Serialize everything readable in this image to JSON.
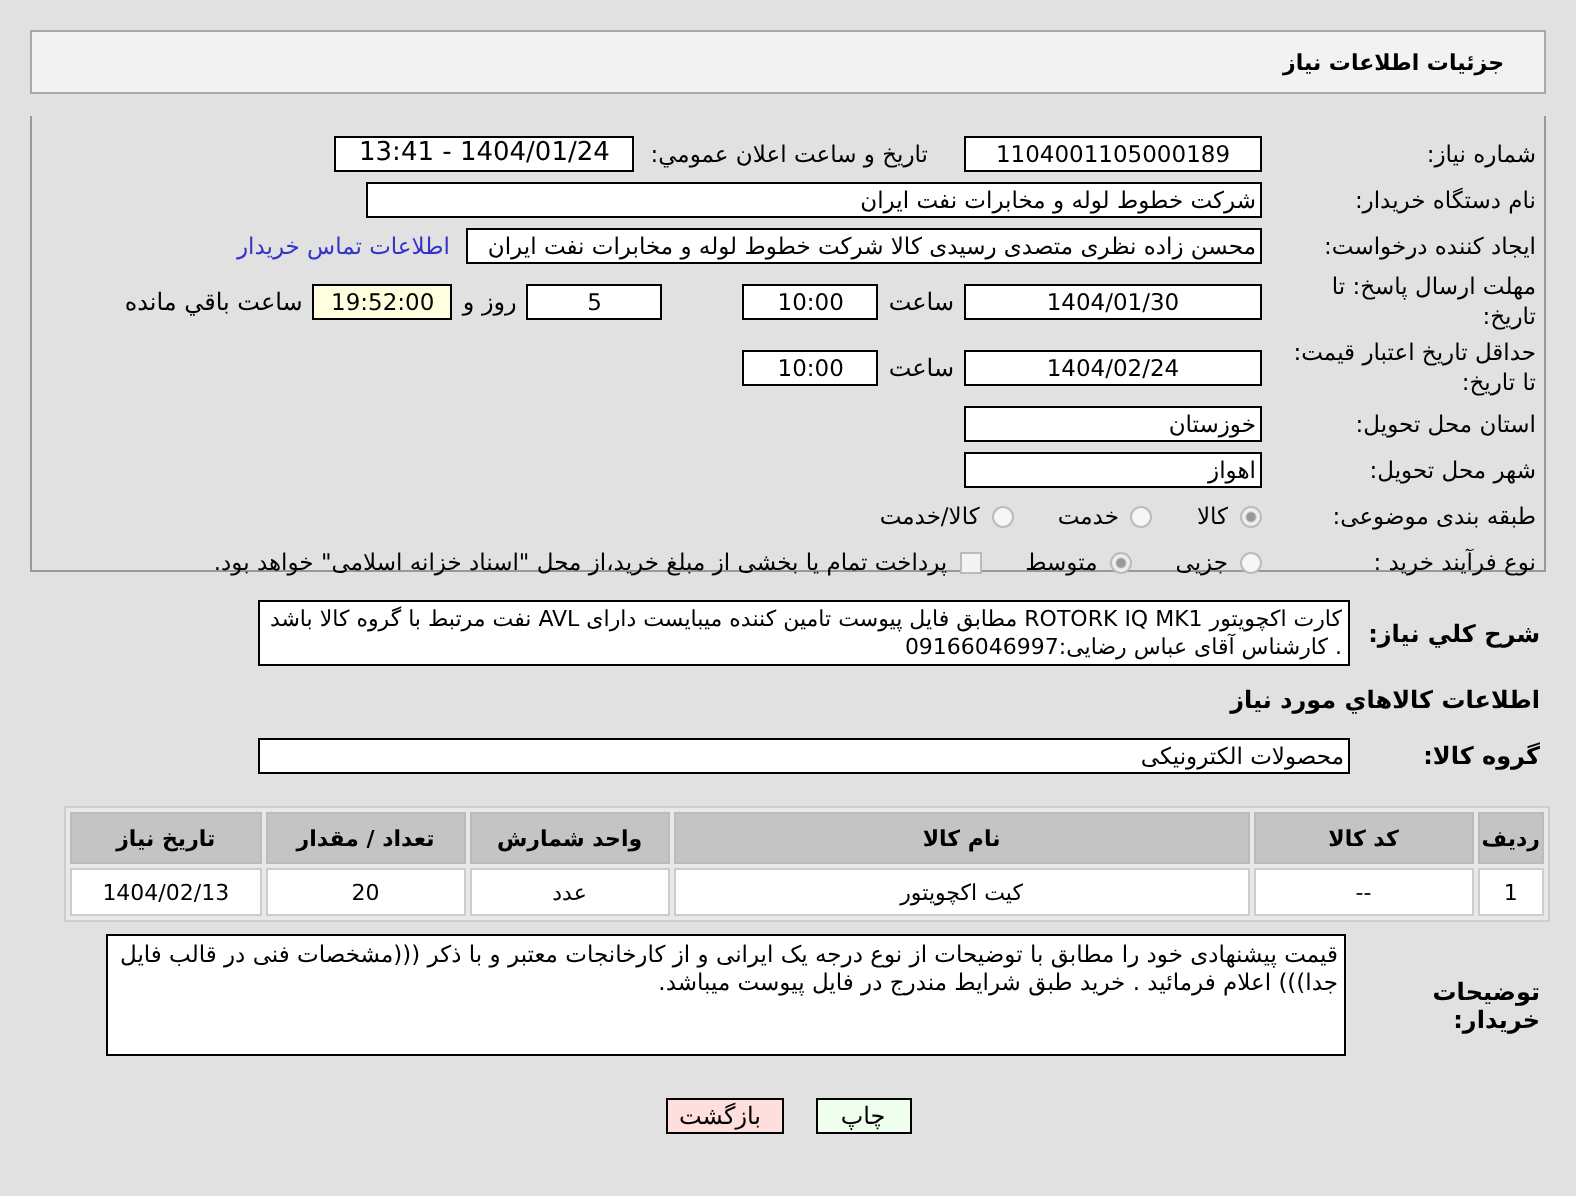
{
  "header": {
    "title": "جزئیات اطلاعات نیاز"
  },
  "form": {
    "need_number": {
      "label": "شماره نیاز:",
      "value": "1104001105000189"
    },
    "announce": {
      "label": "تاریخ و ساعت اعلان عمومي:",
      "value": "1404/01/24 - 13:41"
    },
    "buyer": {
      "label": "نام دستگاه خریدار:",
      "value": "شرکت خطوط لوله و مخابرات نفت ایران"
    },
    "creator": {
      "label": "ایجاد کننده درخواست:",
      "value": "محسن زاده نظری متصدی رسیدی کالا شرکت خطوط لوله و مخابرات نفت ایران",
      "link": "اطلاعات تماس خریدار"
    },
    "deadline": {
      "label": "مهلت ارسال پاسخ: تا تاریخ:",
      "date": "1404/01/30",
      "time_label": "ساعت",
      "time": "10:00",
      "days": "5",
      "days_label": "روز و",
      "remaining": "19:52:00",
      "remaining_label": "ساعت باقي مانده"
    },
    "validity": {
      "label": "حداقل تاریخ اعتبار قیمت: تا تاریخ:",
      "date": "1404/02/24",
      "time_label": "ساعت",
      "time": "10:00"
    },
    "province": {
      "label": "استان محل تحویل:",
      "value": "خوزستان"
    },
    "city": {
      "label": "شهر محل تحویل:",
      "value": "اهواز"
    },
    "category": {
      "label": "طبقه بندی موضوعی:",
      "options": [
        {
          "label": "کالا",
          "selected": true
        },
        {
          "label": "خدمت",
          "selected": false
        },
        {
          "label": "کالا/خدمت",
          "selected": false
        }
      ]
    },
    "process": {
      "label": "نوع فرآیند خرید :",
      "options": [
        {
          "label": "جزیی",
          "selected": false
        },
        {
          "label": "متوسط",
          "selected": true
        }
      ],
      "treasury": {
        "label": "پرداخت تمام یا بخشی از مبلغ خرید،از محل \"اسناد خزانه اسلامی\" خواهد بود.",
        "checked": false
      }
    }
  },
  "description": {
    "label": "شرح کلي نیاز:",
    "value": "کارت اکچویتور ROTORK IQ MK1 مطابق فایل پیوست تامین کننده میبایست دارای AVL نفت مرتبط با گروه کالا باشد . کارشناس آقای عباس رضایی:09166046997"
  },
  "goods_title": "اطلاعات کالاهاي مورد نیاز",
  "goods_group": {
    "label": "گروه کالا:",
    "value": "محصولات الکترونیکی"
  },
  "table": {
    "columns": [
      "ردیف",
      "کد کالا",
      "نام کالا",
      "واحد شمارش",
      "تعداد / مقدار",
      "تاریخ نیاز"
    ],
    "rows": [
      [
        "1",
        "--",
        "کیت اکچویتور",
        "عدد",
        "20",
        "1404/02/13"
      ]
    ]
  },
  "buyer_notes": {
    "label": "توضیحات خریدار:",
    "value": "قیمت پیشنهادی خود را مطابق با توضیحات از نوع درجه یک ایرانی و از کارخانجات معتبر و با ذکر (((مشخصات فنی در قالب فایل جدا))) اعلام فرمائید . خرید طبق شرایط مندرج در فایل پیوست میباشد."
  },
  "buttons": [
    {
      "label": "چاپ",
      "kind": "print"
    },
    {
      "label": "بازگشت",
      "kind": "back"
    }
  ]
}
